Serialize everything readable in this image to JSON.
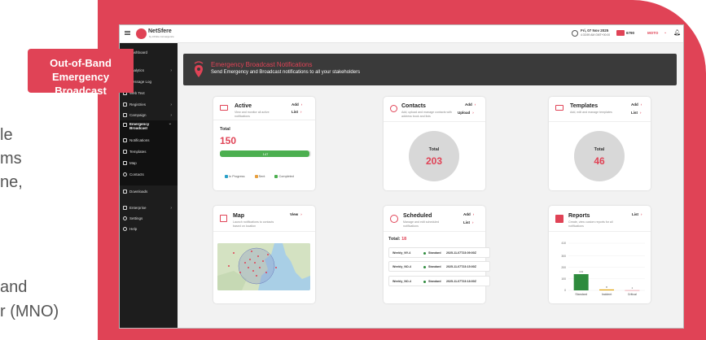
{
  "slide": {
    "tag_line1": "Out-of-Band",
    "tag_line2": "Emergency Broadcast",
    "left_fragments": [
      "le",
      "ms",
      "ne,",
      "and",
      "r (MNO)"
    ]
  },
  "topbar": {
    "logo_text": "NetSfere",
    "logo_sub": "by infinite convergence",
    "date": "Fri, 07 Nov 2025",
    "time": "4:33:59 AM GMT+00:00",
    "badge_count": "6790",
    "user": "MOTO"
  },
  "sidebar": {
    "items": [
      {
        "label": "Dashboard"
      },
      {
        "label": "Analytics"
      },
      {
        "label": "Message Log"
      },
      {
        "label": "Web Text"
      },
      {
        "label": "Registries"
      },
      {
        "label": "Campaign"
      },
      {
        "label": "Emergency Broadcast"
      },
      {
        "label": "Notifications"
      },
      {
        "label": "Templates"
      },
      {
        "label": "Map"
      },
      {
        "label": "Contacts"
      },
      {
        "label": "Downloads"
      },
      {
        "label": "Enterprise"
      },
      {
        "label": "Settings"
      },
      {
        "label": "Help"
      }
    ]
  },
  "banner": {
    "title": "Emergency Broadcast Notifications",
    "subtitle": "Send Emergency and Broadcast notifications to all your stakeholders"
  },
  "active": {
    "title": "Active",
    "sub": "View and monitor all active notifications",
    "add": "Add",
    "list": "List",
    "total_label": "Total",
    "total": "150",
    "bar_value": "147",
    "bar_fraction": 0.98,
    "legend": [
      {
        "label": "In Progress",
        "color": "#2aa0c8"
      },
      {
        "label": "Sent",
        "color": "#e8a040"
      },
      {
        "label": "Completed",
        "color": "#4caf50"
      }
    ]
  },
  "contacts": {
    "title": "Contacts",
    "sub": "Add, upload and manage contacts with address book and lists",
    "add": "Add",
    "upload": "Upload",
    "total_label": "Total",
    "total": "203"
  },
  "templates": {
    "title": "Templates",
    "sub": "Add, edit and manage templates",
    "add": "Add",
    "list": "List",
    "total_label": "Total",
    "total": "46"
  },
  "map": {
    "title": "Map",
    "sub": "Launch notifications to contacts based on location",
    "view": "View"
  },
  "scheduled": {
    "title": "Scheduled",
    "sub": "Manage and edit scheduled notifications",
    "add": "Add",
    "list": "List",
    "total_label": "Total:",
    "total": "18",
    "rows": [
      {
        "name": "Weekly_NY-4",
        "type": "Standard",
        "time": "2025-11-07T23:09:00Z"
      },
      {
        "name": "Weekly_NO-4",
        "type": "Standard",
        "time": "2025-11-07T23:15:00Z"
      },
      {
        "name": "Weekly_NO-4",
        "type": "Standard",
        "time": "2025-11-07T23:18:00Z"
      }
    ]
  },
  "reports": {
    "title": "Reports",
    "sub": "Create, view custom reports for all notifications",
    "list": "List"
  },
  "chart_data": {
    "type": "bar",
    "categories": [
      "Standard",
      "Incident",
      "Critical"
    ],
    "values": [
      141,
      8,
      1
    ],
    "data_labels": [
      "141",
      "8",
      "1"
    ],
    "yticks": [
      "0",
      "100",
      "200",
      "300",
      "410"
    ],
    "ylim": [
      0,
      410
    ],
    "colors": [
      "#2e8b3d",
      "#e0a000",
      "#e04356"
    ]
  }
}
